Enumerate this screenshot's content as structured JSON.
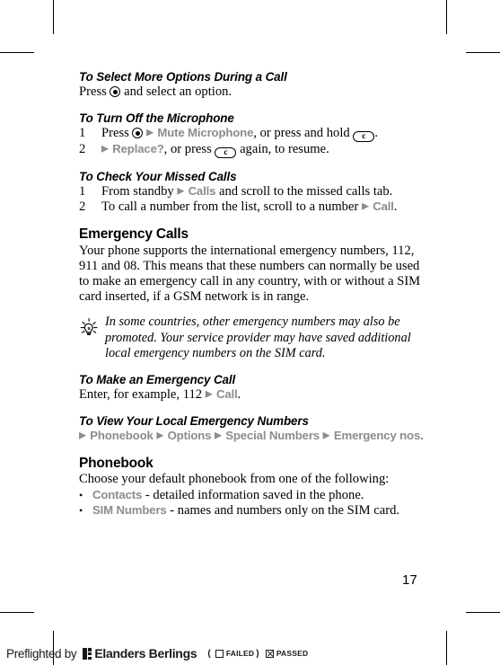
{
  "document": {
    "page_number": "17",
    "colors": {
      "text": "#000000",
      "ui_element_grey": "#8c8c8c",
      "footer": "#1a1a1a"
    }
  },
  "sections": [
    {
      "id": "select-more-options",
      "heading": "To Select More Options During a Call",
      "body_prefix": "Press ",
      "body_suffix": " and select an option."
    },
    {
      "id": "turn-off-microphone",
      "heading": "To Turn Off the Microphone",
      "steps": [
        {
          "num": "1",
          "t1": "Press ",
          "arrow": "▶",
          "ui1": "Mute Microphone",
          "t2": ", or press and hold ",
          "key": "c",
          "t3": "."
        },
        {
          "num": "2",
          "t1": "",
          "arrow": "▶",
          "ui1": "Replace?",
          "t2": ", or press ",
          "key": "c",
          "t3": " again, to resume."
        }
      ]
    },
    {
      "id": "check-missed-calls",
      "heading": "To Check Your Missed Calls",
      "steps": [
        {
          "num": "1",
          "t1": "From standby ",
          "arrow": "▶",
          "ui1": "Calls",
          "t2": " and scroll to the missed calls tab."
        },
        {
          "num": "2",
          "t1": "To call a number from the list, scroll to a number ",
          "arrow": "▶",
          "ui1": "Call",
          "t2": "."
        }
      ]
    },
    {
      "id": "emergency-calls",
      "heading": "Emergency Calls",
      "body": "Your phone supports the international emergency numbers, 112, 911 and 08. This means that these numbers can normally be used to make an emergency call in any country, with or without a SIM card inserted, if a GSM network is in range.",
      "tip": {
        "icon": "lightbulb-tip-icon",
        "text": "In some countries, other emergency numbers may also be promoted. Your service provider may have saved additional local emergency numbers on the SIM card."
      }
    },
    {
      "id": "make-emergency-call",
      "heading": "To Make an Emergency Call",
      "body_prefix": "Enter, for example, 112 ",
      "arrow": "▶",
      "ui1": "Call",
      "body_suffix": "."
    },
    {
      "id": "view-local-emergency-numbers",
      "heading": "To View Your Local Emergency Numbers",
      "path": [
        {
          "arrow": "▶",
          "label": "Phonebook"
        },
        {
          "arrow": "▶",
          "label": "Options"
        },
        {
          "arrow": "▶",
          "label": "Special Numbers"
        },
        {
          "arrow": "▶",
          "label": "Emergency nos."
        }
      ]
    },
    {
      "id": "phonebook",
      "heading": "Phonebook",
      "body": "Choose your default phonebook from one of the following:",
      "bullets": [
        {
          "dot": "•",
          "ui": "Contacts",
          "text": " - detailed information saved in the phone."
        },
        {
          "dot": "•",
          "ui": "SIM Numbers",
          "text": " - names and numbers only on the SIM card."
        }
      ]
    }
  ],
  "preflight": {
    "lead": "Preflighted by",
    "brand": "Elanders Berlings",
    "paren_open": "(",
    "failed_label": "FAILED",
    "paren_close": ")",
    "passed_label": "PASSED"
  }
}
